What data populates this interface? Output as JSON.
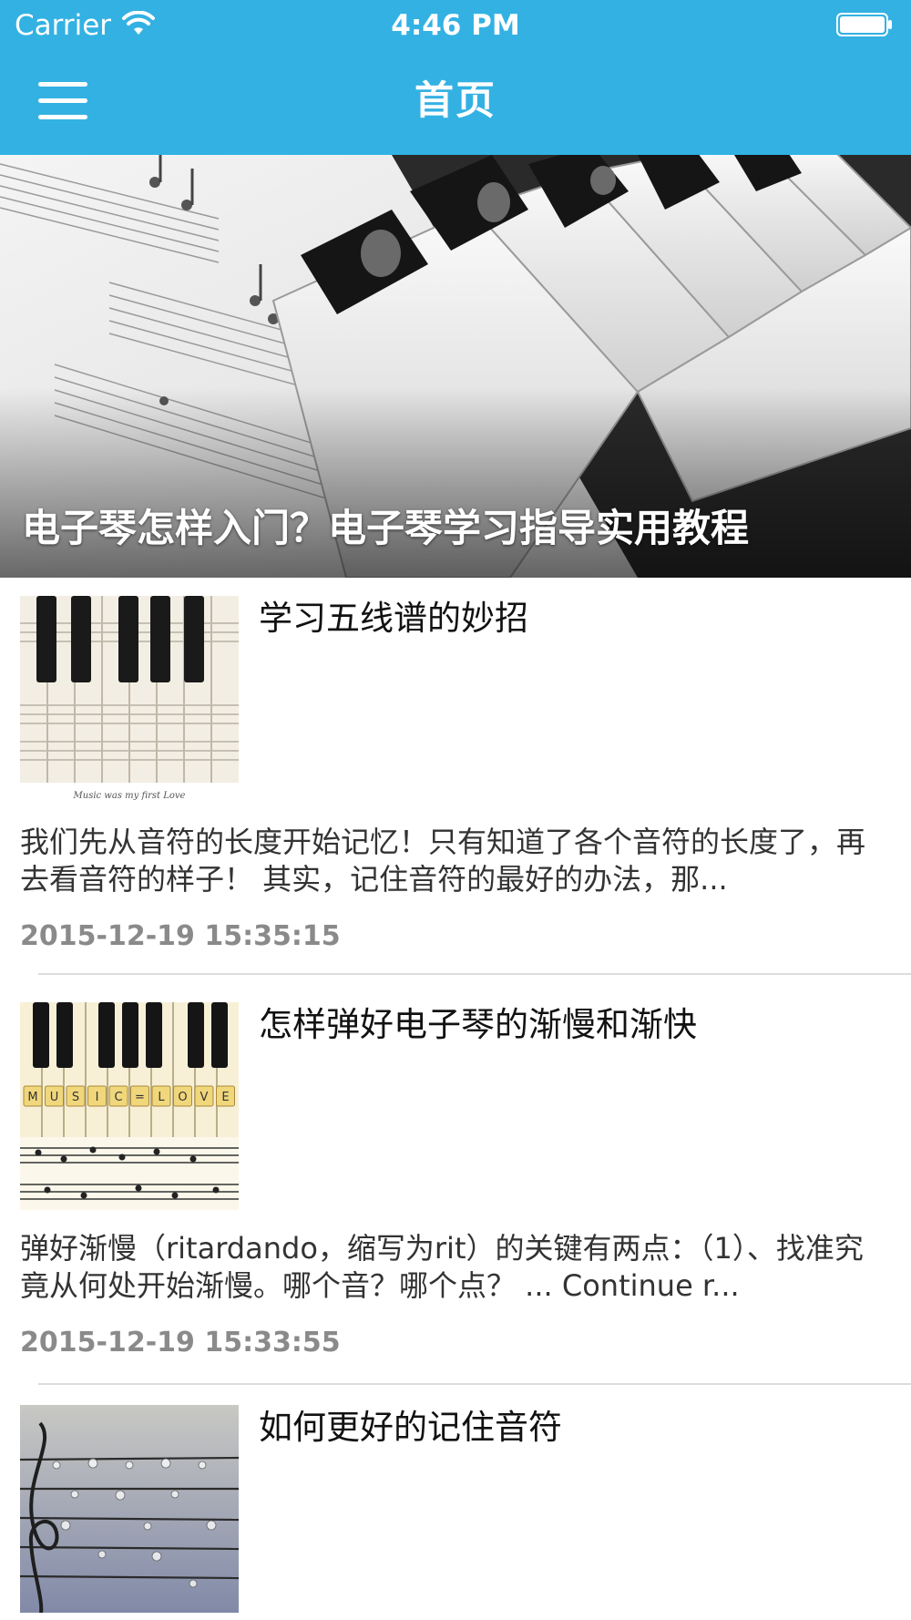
{
  "status_bar": {
    "carrier": "Carrier",
    "time": "4:46 PM",
    "wifi_icon": "wifi-icon",
    "battery_icon": "battery-icon"
  },
  "nav": {
    "title": "首页",
    "menu_icon": "hamburger-menu-icon",
    "background_color": "#33b1e3"
  },
  "hero": {
    "caption": "电子琴怎样入门？电子琴学习指导实用教程",
    "image": "piano-keys-sheet-music-photo"
  },
  "articles": [
    {
      "title": "学习五线谱的妙招",
      "description": "我们先从音符的长度开始记忆！只有知道了各个音符的长度了，再去看音符的样子！ 其实，记住音符的最好的办法，那...",
      "date": "2015-12-19 15:35:15",
      "thumbnail": "piano-keys-sheet-music-thumbnail",
      "thumbnail_caption": "Music was my first Love"
    },
    {
      "title": "怎样弹好电子琴的渐慢和渐快",
      "description": "弹好渐慢（ritardando，缩写为rit）的关键有两点：（1）、找准究竟从何处开始渐慢。哪个音？哪个点？ ... Continue r...",
      "date": "2015-12-19 15:33:55",
      "thumbnail": "music-love-tiles-piano-thumbnail",
      "thumbnail_tiles": [
        "M",
        "U",
        "S",
        "I",
        "C",
        "=",
        "L",
        "O",
        "V",
        "E"
      ]
    },
    {
      "title": "如何更好的记住音符",
      "description": "",
      "date": "",
      "thumbnail": "treble-clef-water-drops-thumbnail"
    }
  ]
}
